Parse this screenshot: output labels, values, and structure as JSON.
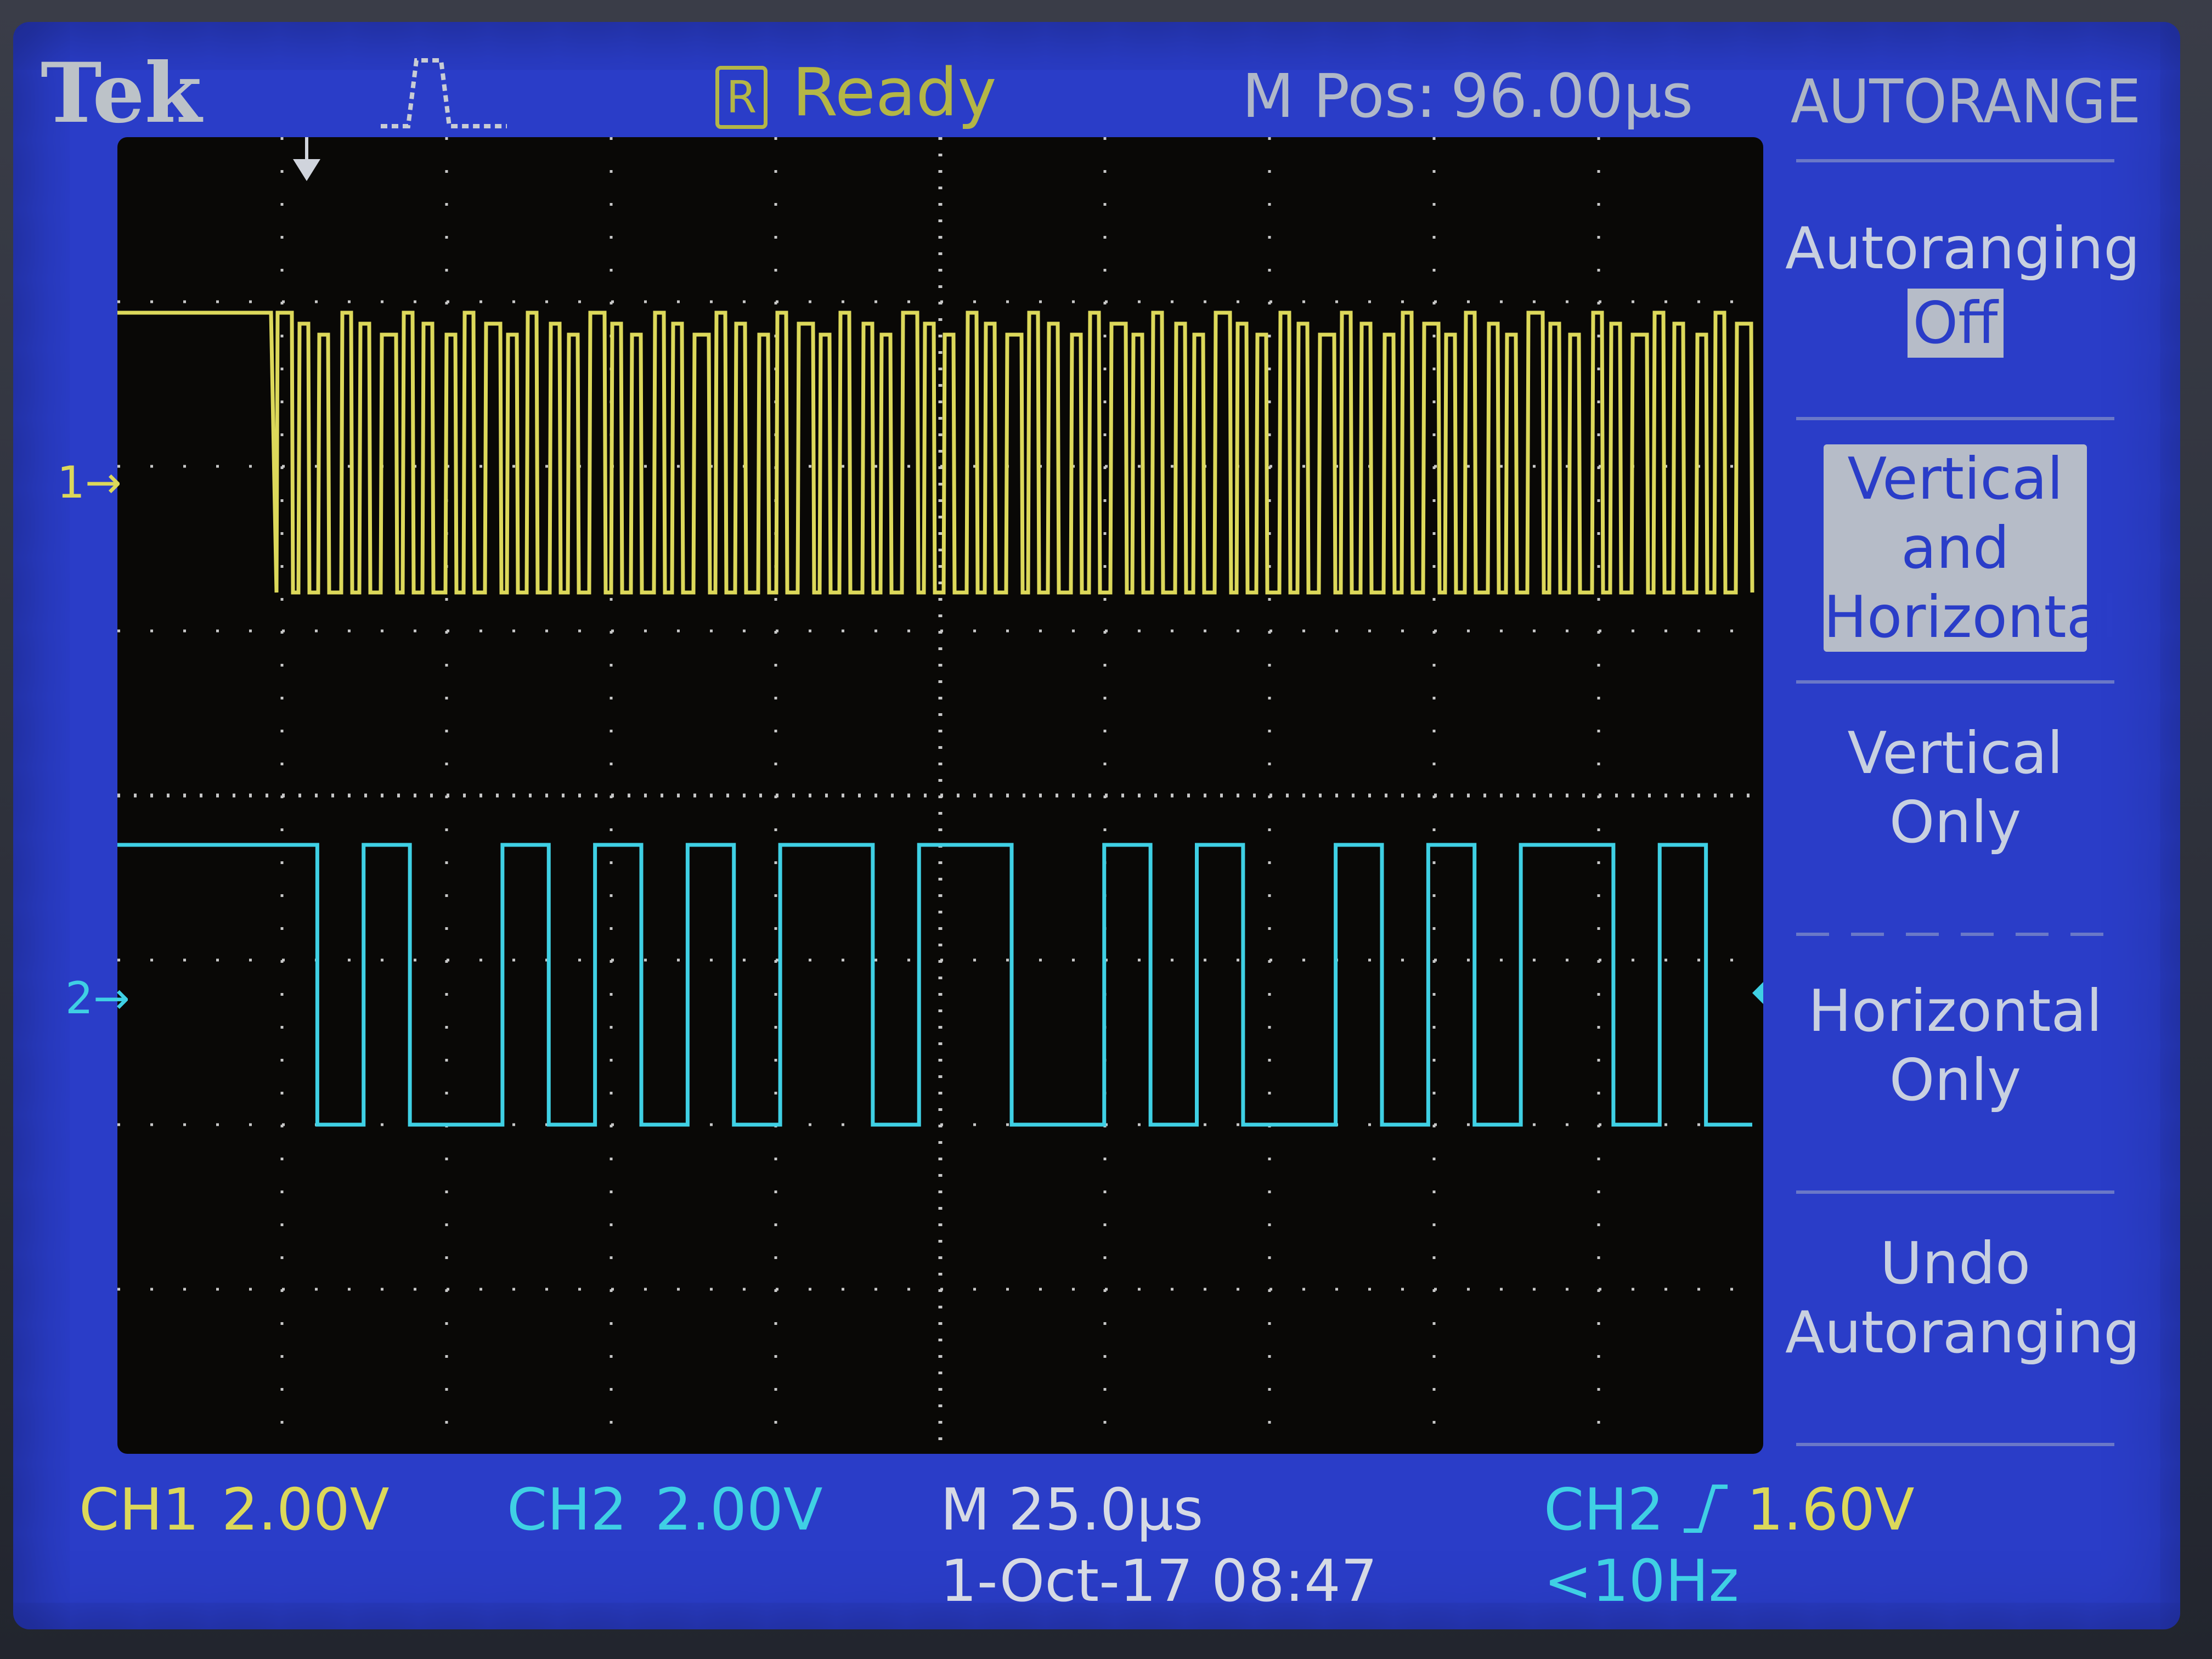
{
  "header": {
    "brand": "Tek",
    "trigger_icon": "pulse-trigger-icon",
    "acquisition_icon_letter": "R",
    "acquisition_status": "Ready",
    "m_pos_label": "M Pos:",
    "m_pos_value": "96.00µs",
    "menu_title": "AUTORANGE"
  },
  "side_menu": {
    "autoranging_label": "Autoranging",
    "autoranging_value": "Off",
    "vertical_and_horizontal": [
      "Vertical",
      "and",
      "Horizontal"
    ],
    "vertical_only": [
      "Vertical",
      "Only"
    ],
    "horizontal_only": [
      "Horizontal",
      "Only"
    ],
    "undo_autoranging": [
      "Undo",
      "Autoranging"
    ]
  },
  "channels": {
    "ch1_marker": "1",
    "ch2_marker": "2"
  },
  "footer": {
    "ch1_label": "CH1",
    "ch1_scale": "2.00V",
    "ch2_label": "CH2",
    "ch2_scale": "2.00V",
    "timebase": "M 25.0µs",
    "datetime": "1-Oct-17 08:47",
    "trigger_source": "CH2",
    "trigger_slope_icon": "rising-edge-icon",
    "trigger_level": "1.60V",
    "trigger_freq": "<10Hz"
  },
  "colors": {
    "screen_bg": "#2a3dc8",
    "ch1": "#dcd85a",
    "ch2": "#3fd0e4",
    "graticule_dots": "#c8c8c8"
  }
}
